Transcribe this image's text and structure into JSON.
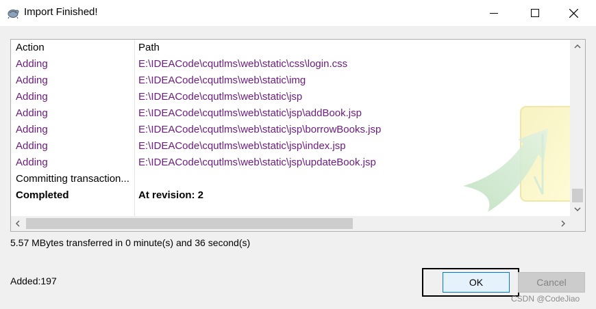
{
  "window": {
    "title": "Import Finished!",
    "controls": {
      "minimize_icon": "minimize-icon",
      "maximize_icon": "maximize-icon",
      "close_icon": "close-icon"
    }
  },
  "log": {
    "headers": {
      "action": "Action",
      "path": "Path"
    },
    "rows": [
      {
        "action": "Adding",
        "path": "E:\\IDEACode\\cqutlms\\web\\static\\css\\login.css",
        "style": "added"
      },
      {
        "action": "Adding",
        "path": "E:\\IDEACode\\cqutlms\\web\\static\\img",
        "style": "added"
      },
      {
        "action": "Adding",
        "path": "E:\\IDEACode\\cqutlms\\web\\static\\jsp",
        "style": "added"
      },
      {
        "action": "Adding",
        "path": "E:\\IDEACode\\cqutlms\\web\\static\\jsp\\addBook.jsp",
        "style": "added"
      },
      {
        "action": "Adding",
        "path": "E:\\IDEACode\\cqutlms\\web\\static\\jsp\\borrowBooks.jsp",
        "style": "added"
      },
      {
        "action": "Adding",
        "path": "E:\\IDEACode\\cqutlms\\web\\static\\jsp\\index.jsp",
        "style": "added"
      },
      {
        "action": "Adding",
        "path": "E:\\IDEACode\\cqutlms\\web\\static\\jsp\\updateBook.jsp",
        "style": "added"
      },
      {
        "action": "Committing transaction...",
        "path": "",
        "style": "normal"
      },
      {
        "action": "Completed",
        "path": "At revision: 2",
        "style": "bold"
      }
    ],
    "horizontal_scroll_fraction": 0.6
  },
  "status": {
    "transfer": "5.57 MBytes transferred in 0 minute(s) and 36 second(s)",
    "added": "Added:197"
  },
  "buttons": {
    "ok": "OK",
    "cancel": "Cancel"
  },
  "credit": "CSDN @CodeJiao",
  "colors": {
    "added_text": "#6a1b7e",
    "accent": "#0078d7"
  }
}
